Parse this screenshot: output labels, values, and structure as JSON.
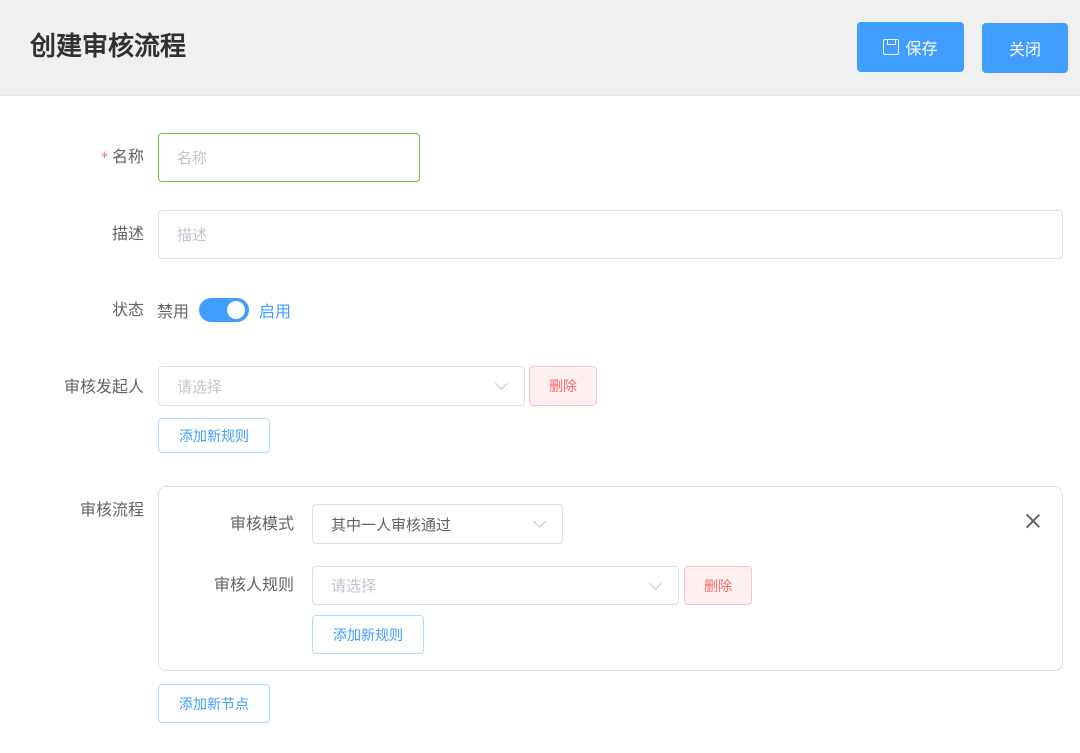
{
  "header": {
    "title": "创建审核流程",
    "save_label": "保存",
    "close_label": "关闭",
    "save_icon": "save-icon"
  },
  "form": {
    "name": {
      "label": "名称",
      "required_mark": "*",
      "placeholder": "名称"
    },
    "description": {
      "label": "描述",
      "placeholder": "描述"
    },
    "status": {
      "label": "状态",
      "off_label": "禁用",
      "on_label": "启用",
      "value": "启用"
    },
    "initiator": {
      "label": "审核发起人",
      "placeholder": "请选择",
      "delete_label": "删除",
      "add_rule_label": "添加新规则"
    },
    "flow": {
      "label": "审核流程",
      "node": {
        "mode_label": "审核模式",
        "mode_value": "其中一人审核通过",
        "reviewer_label": "审核人规则",
        "reviewer_placeholder": "请选择",
        "delete_label": "删除",
        "add_rule_label": "添加新规则",
        "close_icon": "close-icon"
      },
      "add_node_label": "添加新节点"
    }
  },
  "colors": {
    "primary": "#409eff",
    "danger": "#f56c6c",
    "focus_border": "#67c23a"
  }
}
